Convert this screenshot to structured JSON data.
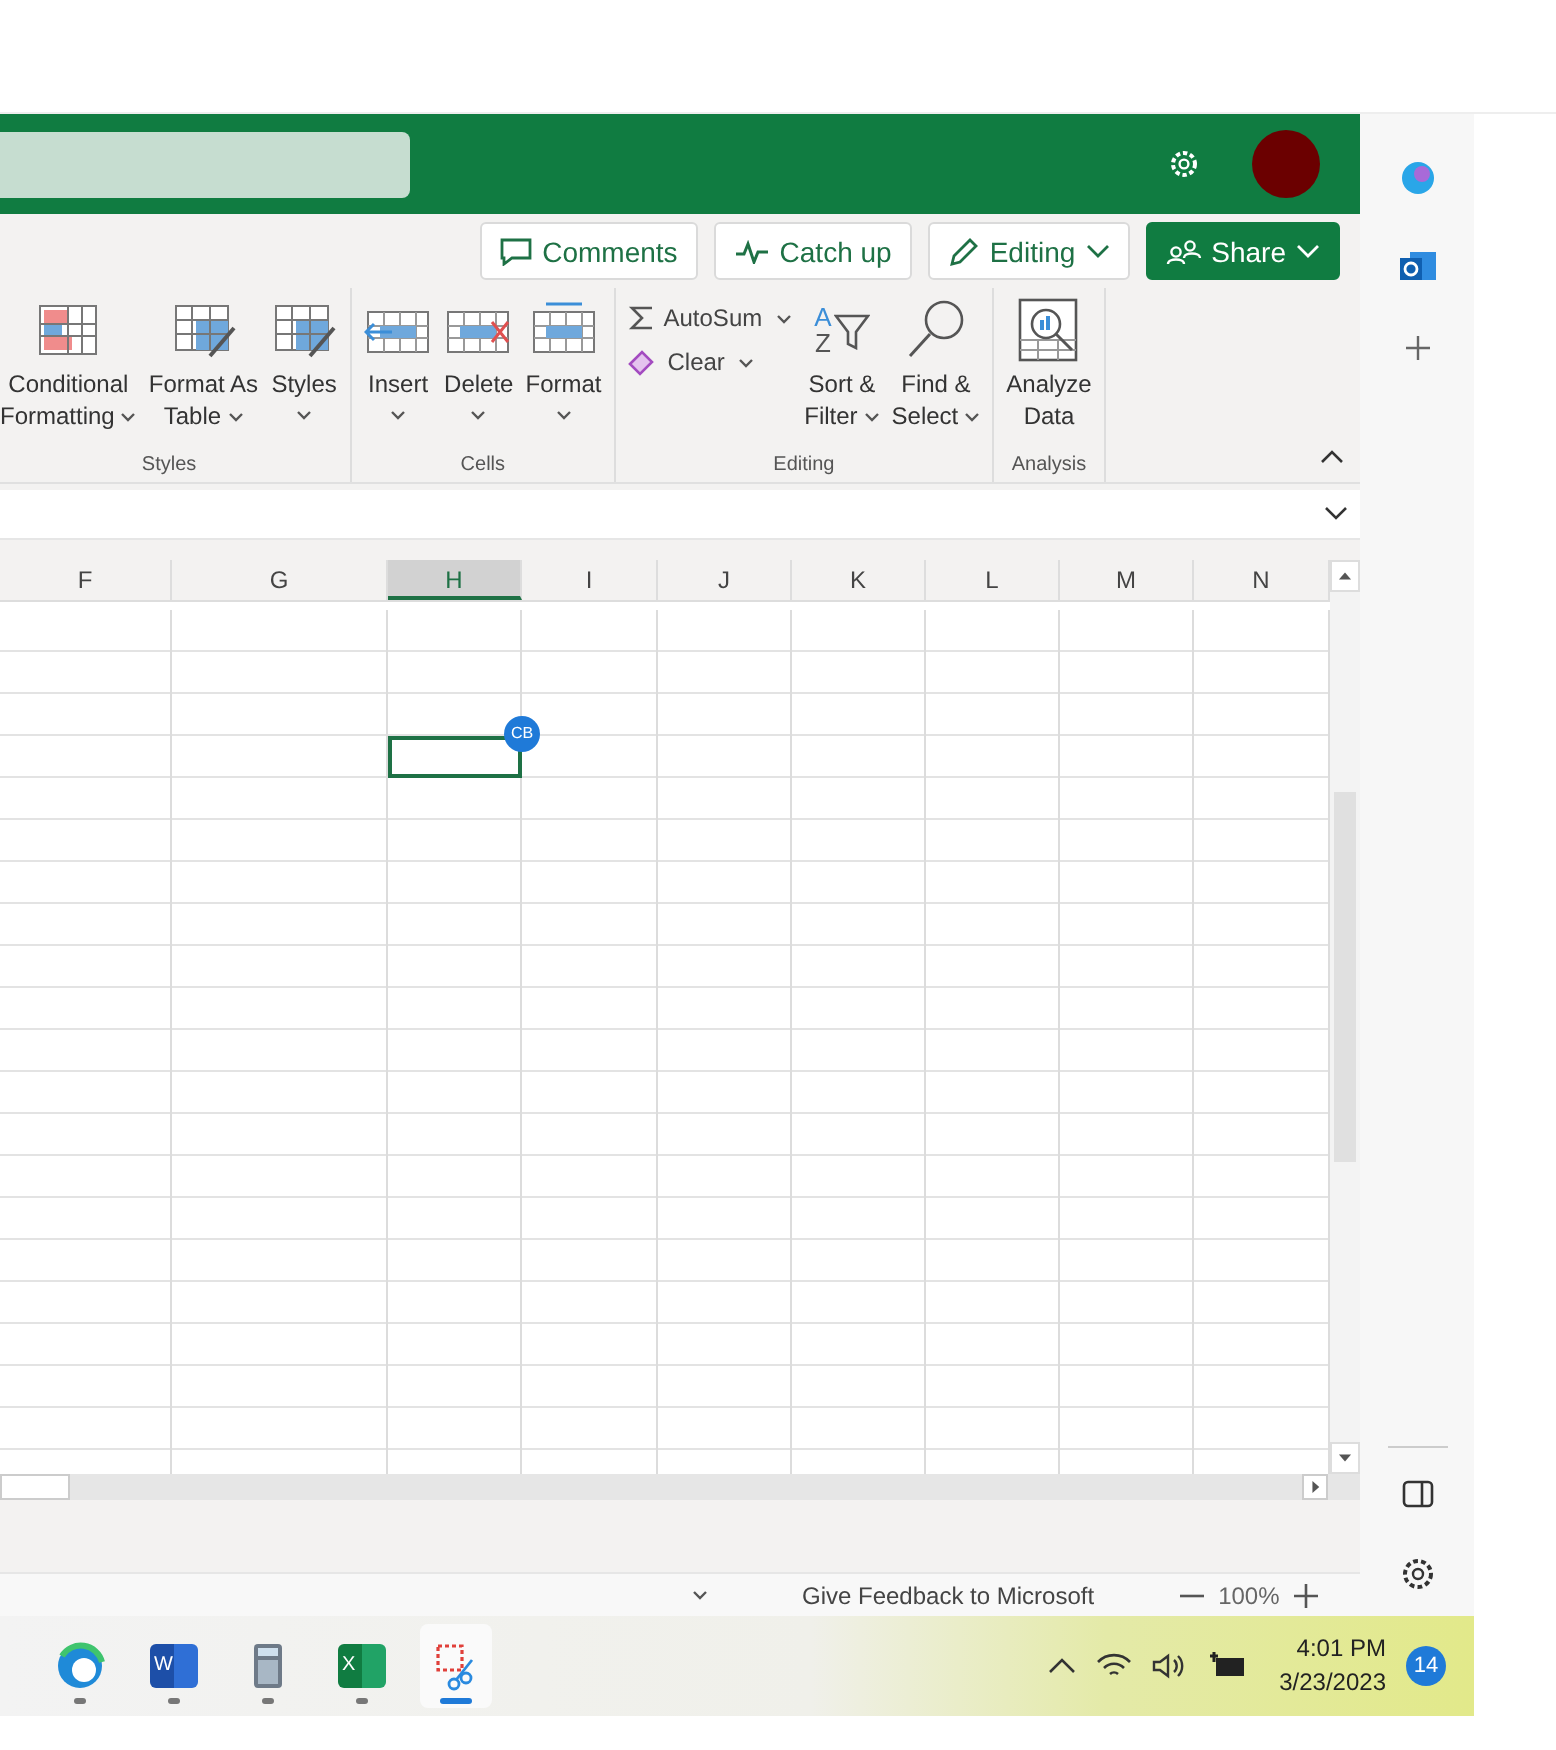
{
  "ribbon_actions": [
    {
      "label": "Comments",
      "kind": "comments"
    },
    {
      "label": "Catch up",
      "kind": "catchup"
    },
    {
      "label": "Editing",
      "kind": "editing"
    },
    {
      "label": "Share",
      "kind": "share"
    }
  ],
  "ribbon_groups": [
    {
      "name": "Styles",
      "commands": [
        {
          "kind": "conditional",
          "lines": [
            "Conditional",
            "Formatting"
          ],
          "dropdown": true
        },
        {
          "kind": "table",
          "lines": [
            "Format As",
            "Table"
          ],
          "dropdown": true
        },
        {
          "kind": "styles",
          "lines": [
            "Styles"
          ],
          "dropdown": true
        }
      ]
    },
    {
      "name": "Cells",
      "commands": [
        {
          "kind": "insert",
          "lines": [
            "Insert"
          ],
          "dropdown": true
        },
        {
          "kind": "delete",
          "lines": [
            "Delete"
          ],
          "dropdown": true
        },
        {
          "kind": "format",
          "lines": [
            "Format"
          ],
          "dropdown": true
        }
      ]
    },
    {
      "name": "Editing",
      "small": [
        {
          "kind": "autosum",
          "label": "AutoSum"
        },
        {
          "kind": "clear",
          "label": "Clear"
        }
      ],
      "commands": [
        {
          "kind": "sort",
          "icon_letters": [
            "A",
            "Z"
          ],
          "lines": [
            "Sort &",
            "Filter"
          ],
          "dropdown": true
        },
        {
          "kind": "find",
          "lines": [
            "Find &",
            "Select"
          ],
          "dropdown": true
        }
      ]
    },
    {
      "name": "Analysis",
      "commands": [
        {
          "kind": "analyze",
          "lines": [
            "Analyze",
            "Data"
          ],
          "dropdown": false
        }
      ]
    }
  ],
  "columns": [
    {
      "label": "F",
      "selected": false
    },
    {
      "label": "G",
      "selected": false
    },
    {
      "label": "H",
      "selected": true
    },
    {
      "label": "I",
      "selected": false
    },
    {
      "label": "J",
      "selected": false
    },
    {
      "label": "K",
      "selected": false
    },
    {
      "label": "L",
      "selected": false
    },
    {
      "label": "M",
      "selected": false
    },
    {
      "label": "N",
      "selected": false
    }
  ],
  "presence_badge": "CB",
  "status_bar": {
    "feedback": "Give Feedback to Microsoft",
    "zoom": "100%"
  },
  "taskbar": {
    "apps": [
      {
        "kind": "edge",
        "selected": false
      },
      {
        "kind": "word",
        "letter": "W",
        "selected": false
      },
      {
        "kind": "calculator",
        "selected": false
      },
      {
        "kind": "excel",
        "letter": "X",
        "selected": false
      },
      {
        "kind": "snipping",
        "selected": true
      }
    ],
    "time": "4:01 PM",
    "date": "3/23/2023",
    "notifications": "14"
  }
}
